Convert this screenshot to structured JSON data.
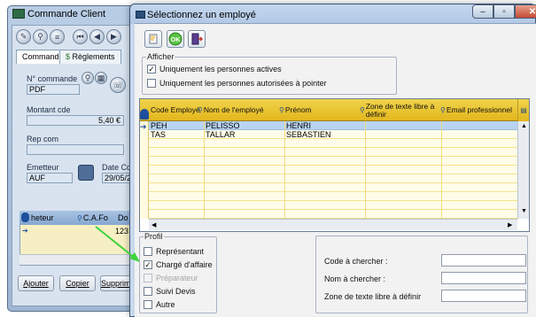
{
  "background_window": {
    "title": "Commande Client",
    "tabs": [
      "Commande",
      "Règlements",
      "C"
    ],
    "fields": {
      "n_commande_label": "N° commande",
      "n_commande_value": "PDF",
      "montant_label": "Montant cde",
      "montant_value": "5,40 €",
      "rep_label": "Rep com",
      "emetteur_label": "Emetteur",
      "emetteur_value": "AUF",
      "date_label": "Date Cde",
      "date_value": "29/05/2"
    },
    "mini_table": {
      "col1": "heteur",
      "col2": "C.A.Fo",
      "col3": "Do",
      "row_value": "123"
    },
    "buttons": {
      "ajouter": "Ajouter",
      "copier": "Copier",
      "supprimer": "Supprime"
    }
  },
  "dialog": {
    "title": "Sélectionnez un employé",
    "toolbar": {
      "ok_label": "OK"
    },
    "afficher": {
      "legend": "Afficher",
      "options": [
        {
          "label": "Uniquement les personnes actives",
          "checked": true
        },
        {
          "label": "Uniquement les personnes autorisées à pointer",
          "checked": false
        }
      ]
    },
    "table": {
      "columns": [
        "Code Employé",
        "Nom de l'employé",
        "Prénom",
        "Zone de texte libre à définir",
        "Email professionnel"
      ],
      "rows": [
        {
          "code": "PEH",
          "nom": "PELISSO",
          "prenom": "HENRI",
          "zone": "",
          "email": ""
        },
        {
          "code": "TAS",
          "nom": "TALLAR",
          "prenom": "SEBASTIEN",
          "zone": "",
          "email": ""
        }
      ]
    },
    "profil": {
      "legend": "Profil",
      "options": [
        {
          "label": "Représentant",
          "checked": false,
          "disabled": false
        },
        {
          "label": "Chargé d'affaire",
          "checked": true,
          "disabled": false
        },
        {
          "label": "Préparateur",
          "checked": false,
          "disabled": true
        },
        {
          "label": "Suivi Devis",
          "checked": false,
          "disabled": false
        },
        {
          "label": "Autre",
          "checked": false,
          "disabled": false
        }
      ]
    },
    "search": {
      "code_label": "Code à chercher :",
      "code_value": "",
      "nom_label": "Nom à chercher :",
      "nom_value": "",
      "zone_label": "Zone de texte libre à définir",
      "zone_value": ""
    }
  },
  "colors": {
    "header_gold": "#e8c02a",
    "selected_row": "#b9d4f1",
    "arrow_green": "#3fd23f"
  }
}
